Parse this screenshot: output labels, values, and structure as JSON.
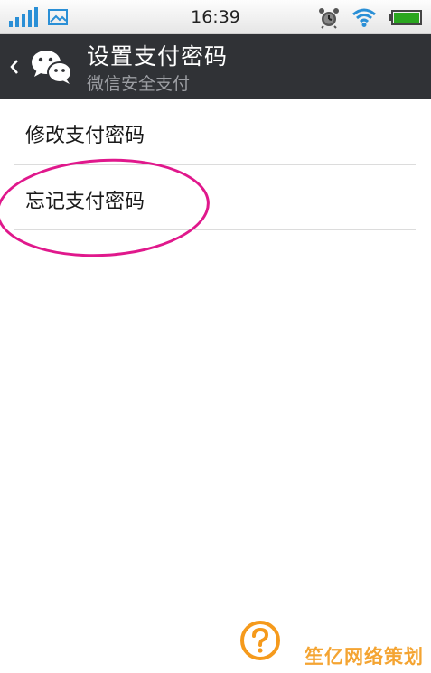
{
  "status_bar": {
    "time": "16:39",
    "icons": [
      "signal-icon",
      "gallery-icon",
      "alarm-icon",
      "wifi-icon",
      "battery-icon"
    ]
  },
  "action_bar": {
    "title": "设置支付密码",
    "subtitle": "微信安全支付",
    "back_icon": "chevron-left-icon",
    "logo_icon": "wechat-icon"
  },
  "menu": {
    "items": [
      {
        "label": "修改支付密码"
      },
      {
        "label": "忘记支付密码"
      }
    ]
  },
  "annotation": {
    "highlight_color": "#e0188c"
  },
  "footer": {
    "help_icon": "question-circle-icon",
    "watermark": "笙亿网络策划"
  },
  "colors": {
    "action_bar_bg": "#303236",
    "accent_orange": "#f59a1c",
    "battery_green": "#2aa61f"
  }
}
